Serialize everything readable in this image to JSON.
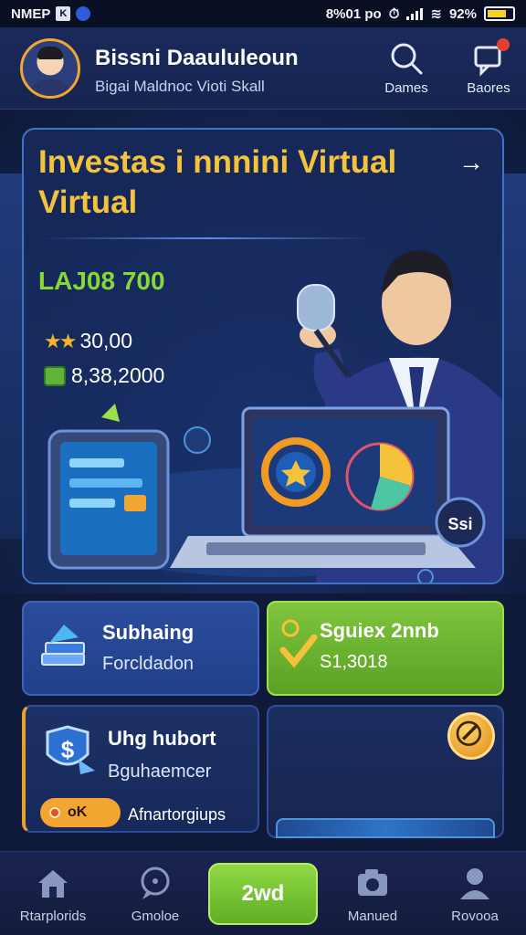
{
  "status_bar": {
    "left_text": "NMEP",
    "left_box": "K",
    "time": "8%01 po",
    "battery": "92%"
  },
  "header": {
    "title": "Bissni Daaululeoun",
    "subtitle": "Bigai Maldnoc Vioti Skall",
    "actions": [
      {
        "label": "Dames",
        "icon": "search-icon"
      },
      {
        "label": "Baores",
        "icon": "notification-icon"
      }
    ]
  },
  "hero": {
    "title": "Investas i nnnini Virtual Virtual",
    "arrow": "→",
    "amount": "LAJ08 700",
    "stat_1": "30,00",
    "stat_2": "8,38,2000",
    "device_badge": "Ssi"
  },
  "cards": [
    {
      "title": "Subhaing",
      "subtitle": "Forcldadon",
      "icon": "stacked-books-icon"
    },
    {
      "title": "Sguiex 2nnb",
      "subtitle": "S1,3018",
      "icon": "checkmark-icon"
    },
    {
      "title": "Uhg hubort",
      "subtitle": "Bguhaemcer",
      "pill": "oK",
      "footer": "Afnartorgiups",
      "icon": "dollar-shield-icon"
    },
    {
      "icon": "gold-badge-icon"
    }
  ],
  "bottom_nav": [
    {
      "label": "Rtarplorids",
      "icon": "home-icon"
    },
    {
      "label": "Gmoloe",
      "icon": "chat-icon"
    },
    {
      "label": "2wd",
      "icon": ""
    },
    {
      "label": "Manued",
      "icon": "camera-icon"
    },
    {
      "label": "Rovooa",
      "icon": "profile-icon"
    }
  ],
  "colors": {
    "accent_gold": "#f5c23b",
    "accent_green": "#88d832",
    "background": "#0f1a3a",
    "card_blue": "#2a4d9c"
  }
}
